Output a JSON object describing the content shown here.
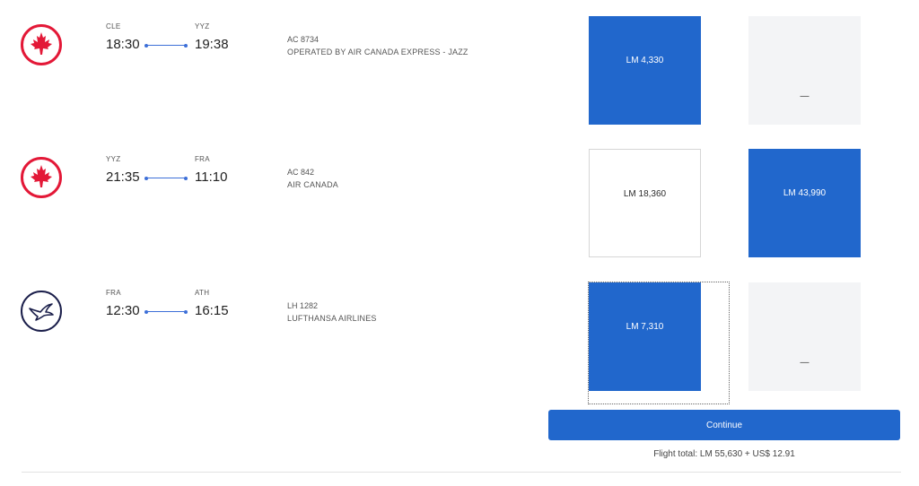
{
  "segments": [
    {
      "airline": "Air Canada Express - Jazz",
      "logo": "air-canada-maple-leaf-icon",
      "origin": "CLE",
      "destination": "YYZ",
      "depart": "18:30",
      "arrive": "19:38",
      "flight_number": "AC 8734",
      "operator": "OPERATED BY AIR CANADA EXPRESS - JAZZ",
      "fares": [
        {
          "label": "LM 4,330",
          "state": "selected"
        },
        {
          "label": "—",
          "state": "unavailable"
        }
      ]
    },
    {
      "airline": "Air Canada",
      "logo": "air-canada-maple-leaf-icon",
      "origin": "YYZ",
      "destination": "FRA",
      "depart": "21:35",
      "arrive": "11:10",
      "flight_number": "AC 842",
      "operator": "AIR CANADA",
      "fares": [
        {
          "label": "LM 18,360",
          "state": "available"
        },
        {
          "label": "LM 43,990",
          "state": "selected"
        }
      ]
    },
    {
      "airline": "Lufthansa",
      "logo": "lufthansa-crane-icon",
      "origin": "FRA",
      "destination": "ATH",
      "depart": "12:30",
      "arrive": "16:15",
      "flight_number": "LH 1282",
      "operator": "LUFTHANSA AIRLINES",
      "fares": [
        {
          "label": "LM 7,310",
          "state": "selected"
        },
        {
          "label": "—",
          "state": "unavailable"
        }
      ]
    }
  ],
  "continue_label": "Continue",
  "flight_total": "Flight total: LM 55,630 + US$ 12.91",
  "colors": {
    "accent": "#2167cc",
    "air_canada_red": "#e31837",
    "lufthansa_navy": "#1b1f4b",
    "unavailable_bg": "#f3f4f6"
  }
}
